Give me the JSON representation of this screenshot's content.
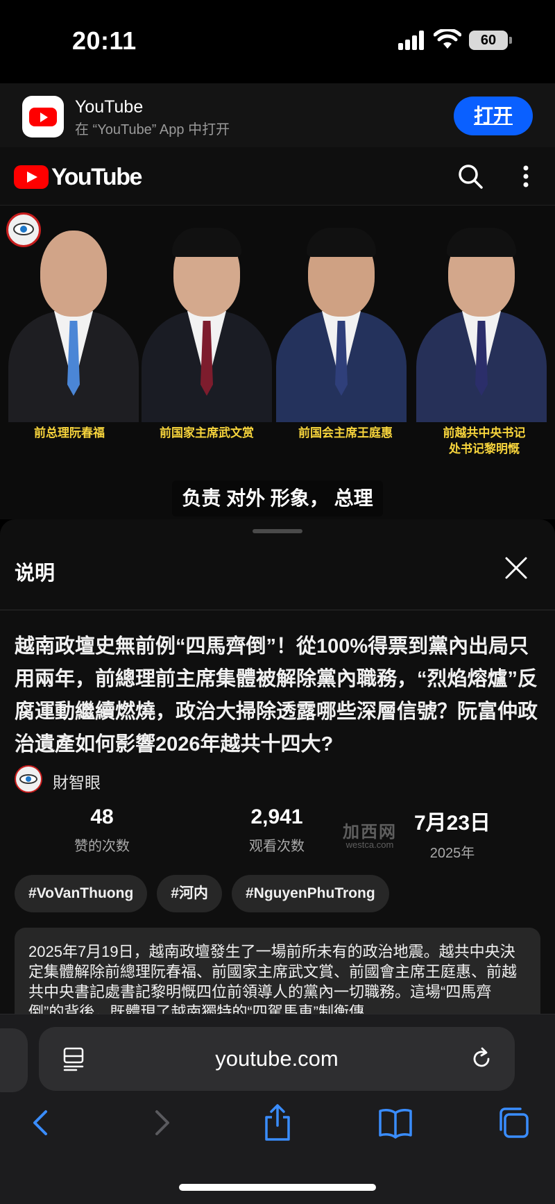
{
  "status_bar": {
    "time": "20:11",
    "battery": "60"
  },
  "app_banner": {
    "name": "YouTube",
    "subtitle": "在 “YouTube” App 中打开",
    "open_label": "打开",
    "icon": "youtube-app-icon"
  },
  "header": {
    "logo_text": "YouTube",
    "search_icon": "search-icon",
    "more_icon": "more-vertical-icon"
  },
  "video": {
    "people": [
      {
        "caption": "前总理阮春福"
      },
      {
        "caption": "前国家主席武文赏"
      },
      {
        "caption": "前国会主席王庭惠"
      },
      {
        "caption": "前越共中央书记处书记黎明慨"
      }
    ],
    "subtitle": "负责 对外 形象， 总理"
  },
  "sheet": {
    "title": "说明",
    "video_title": "越南政壇史無前例“四馬齊倒”！從100%得票到黨內出局只用兩年，前總理前主席集體被解除黨內職務，“烈焰熔爐”反腐運動繼續燃燒，政治大掃除透露哪些深層信號？阮富仲政治遺產如何影響2026年越共十四大?",
    "channel_name": "財智眼",
    "stats": [
      {
        "value": "48",
        "label": "赞的次数"
      },
      {
        "value": "2,941",
        "label": "观看次数"
      },
      {
        "value": "7月23日",
        "label": "2025年"
      }
    ],
    "watermark": {
      "line1": "加西网",
      "line2": "westca.com"
    },
    "tags": [
      "#VoVanThuong",
      "#河内",
      "#NguyenPhuTrong"
    ],
    "description": "2025年7月19日，越南政壇發生了一場前所未有的政治地震。越共中央決定集體解除前總理阮春福、前國家主席武文賞、前國會主席王庭惠、前越共中央書記處書記黎明慨四位前領導人的黨內一切職務。這場“四馬齊倒”的背後，既體現了越南獨特的“四駕馬車”制衡傳"
  },
  "safari": {
    "url": "youtube.com"
  },
  "colors": {
    "accent_blue": "#0a60ff",
    "youtube_red": "#ff0000",
    "caption_yellow": "#f7d43c"
  }
}
